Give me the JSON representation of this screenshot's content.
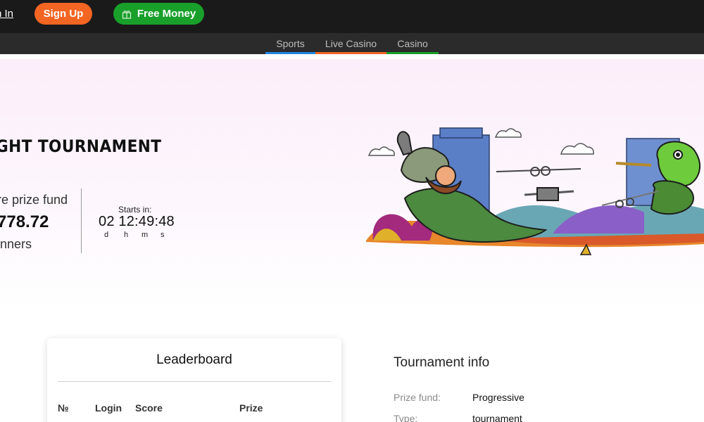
{
  "header": {
    "signin_label": "n In",
    "signup_label": "Sign Up",
    "free_money_label": "Free Money",
    "free_money_icon": "gift-icon"
  },
  "nav": {
    "items": [
      {
        "label": "Sports",
        "color": "#1e88e5"
      },
      {
        "label": "Live Casino",
        "color": "#f26522"
      },
      {
        "label": "Casino",
        "color": "#18a02a"
      }
    ]
  },
  "hero": {
    "title": "GHT TOURNAMENT",
    "prize_fund_label": "re prize fund",
    "prize_fund_value": "778.72",
    "winners_label": "inners",
    "starts_label": "Starts in:",
    "countdown": "02 12:49:48",
    "units": {
      "d": "d",
      "h": "h",
      "m": "m",
      "s": "s"
    }
  },
  "leaderboard": {
    "title": "Leaderboard",
    "columns": [
      "№",
      "Login",
      "Score",
      "Prize"
    ]
  },
  "info": {
    "title": "Tournament info",
    "rows": [
      {
        "label": "Prize fund:",
        "value": "Progressive"
      },
      {
        "label": "Type:",
        "value": "tournament"
      }
    ]
  },
  "colors": {
    "signup": "#f26522",
    "free_money": "#18a02a",
    "topbar": "#1a1a1a",
    "navbar": "#2b2b2b"
  }
}
